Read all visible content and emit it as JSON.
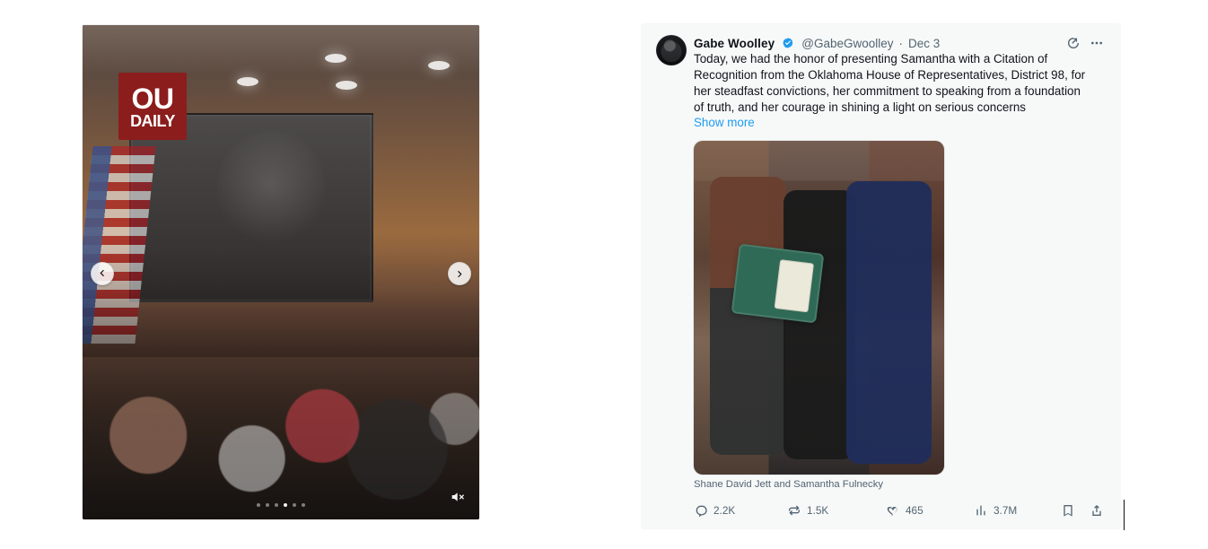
{
  "left_panel": {
    "logo": {
      "line1": "OU",
      "line2": "DAILY"
    },
    "carousel": {
      "dots_count": 6,
      "active_dot_index": 3
    },
    "icons": {
      "prev": "chevron-left-icon",
      "next": "chevron-right-icon",
      "mute": "mute-icon"
    }
  },
  "tweet": {
    "author": {
      "name": "Gabe Woolley",
      "handle": "@GabeGwoolley",
      "separator": "·",
      "date": "Dec 3",
      "verified_color": "#1d9bf0"
    },
    "text": "Today, we had the honor of presenting Samantha with a Citation of\nRecognition from the Oklahoma House of Representatives, District 98, for\nher steadfast convictions, her commitment to speaking from a foundation\nof truth, and her courage in shining a light on serious concerns",
    "show_more_label": "Show more",
    "media_caption": "Shane David Jett and Samantha Fulnecky",
    "actions": {
      "replies": "2.2K",
      "reposts": "1.5K",
      "likes": "465",
      "views": "3.7M"
    },
    "icons": {
      "grok": "grok-icon",
      "more": "more-icon",
      "reply": "reply-icon",
      "repost": "repost-icon",
      "like": "like-icon",
      "views": "views-icon",
      "bookmark": "bookmark-icon",
      "share": "share-icon"
    },
    "colors": {
      "text": "#0f1419",
      "muted": "#536471",
      "link": "#1d9bf0",
      "card_bg": "#f7f9f9"
    }
  }
}
